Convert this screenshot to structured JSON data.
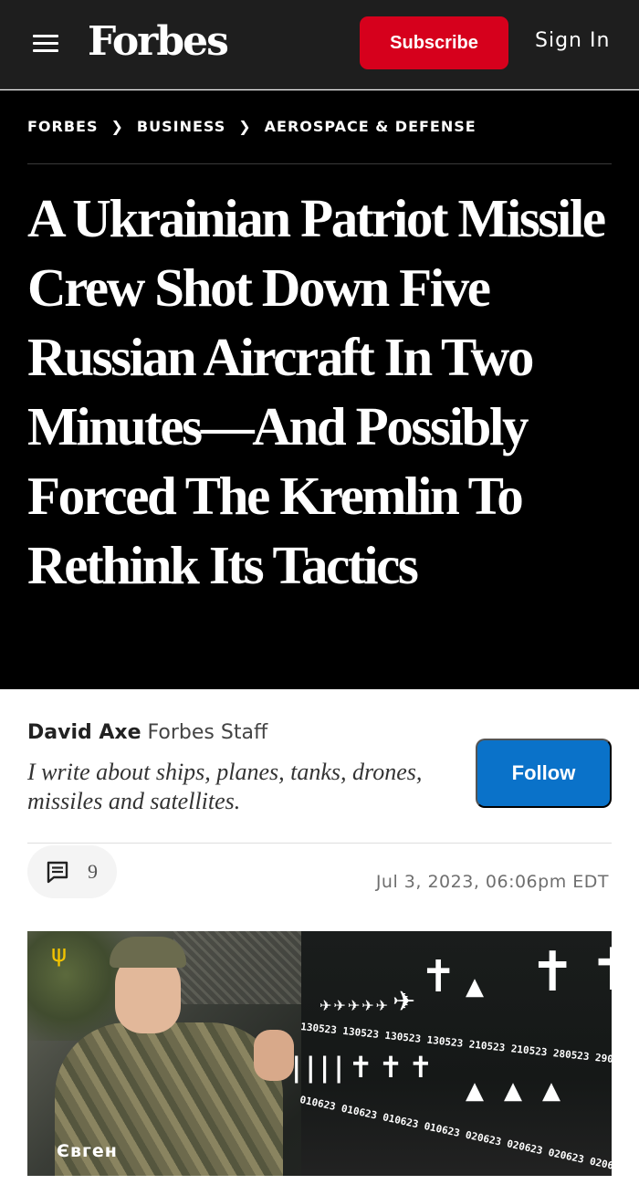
{
  "nav": {
    "logo": "Forbes",
    "subscribe_label": "Subscribe",
    "signin_label": "Sign In"
  },
  "breadcrumb": [
    "FORBES",
    "BUSINESS",
    "AEROSPACE & DEFENSE"
  ],
  "headline": "A Ukrainian Patriot Missile Crew Shot Down Five Russian Aircraft In Two Minutes—And Possibly Forced The Kremlin To Rethink Its Tactics",
  "author": {
    "name": "David Axe",
    "role": "Forbes Staff",
    "bio": "I write about ships, planes, tanks, drones, missiles and satellites.",
    "follow_label": "Follow"
  },
  "meta": {
    "comment_count": "9",
    "date": "Jul 3, 2023, 06:06pm EDT"
  },
  "image": {
    "name_tag": "Євген",
    "kill_dates_top": "130523  130523  130523  130523  210523  210523  280523  290523  290",
    "kill_dates_bottom": "010623  010623  010623  010623  020623  020623  020623  020623  020"
  }
}
